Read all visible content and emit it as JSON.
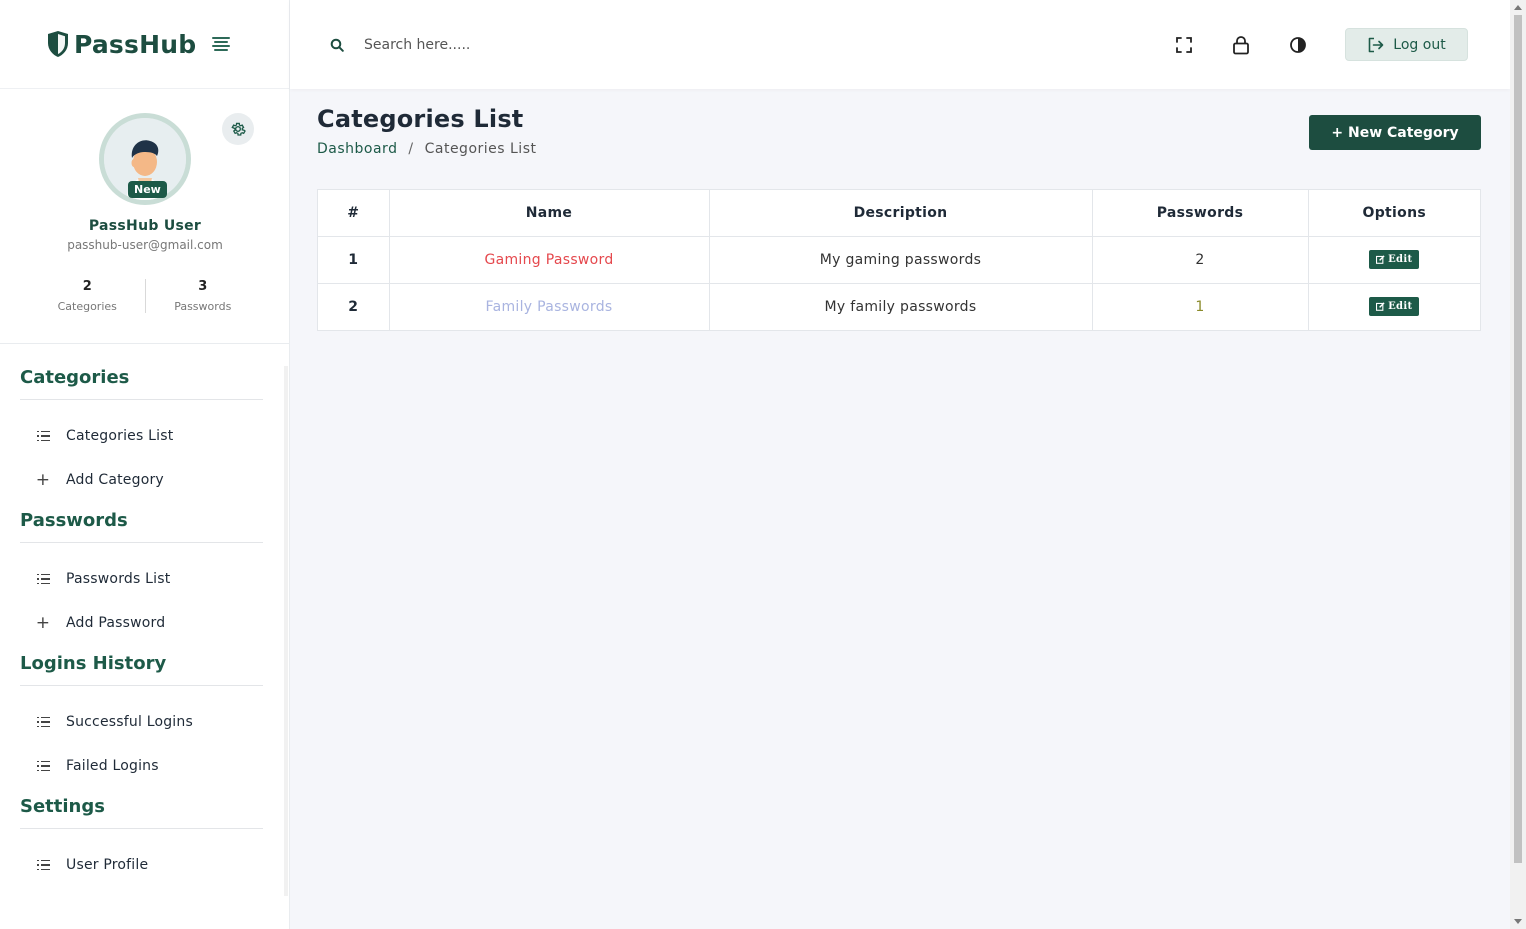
{
  "app": {
    "logo_text": "PassHub"
  },
  "profile": {
    "name": "PassHub User",
    "email": "passhub-user@gmail.com",
    "badge": "New",
    "stats": [
      {
        "value": "2",
        "label": "Categories"
      },
      {
        "value": "3",
        "label": "Passwords"
      }
    ]
  },
  "nav": {
    "sections": [
      {
        "title": "Categories",
        "items": [
          {
            "label": "Categories List",
            "icon": "list-icon"
          },
          {
            "label": "Add Category",
            "icon": "plus-icon"
          }
        ]
      },
      {
        "title": "Passwords",
        "items": [
          {
            "label": "Passwords List",
            "icon": "list-icon"
          },
          {
            "label": "Add Password",
            "icon": "plus-icon"
          }
        ]
      },
      {
        "title": "Logins History",
        "items": [
          {
            "label": "Successful Logins",
            "icon": "list-icon"
          },
          {
            "label": "Failed Logins",
            "icon": "list-icon"
          }
        ]
      },
      {
        "title": "Settings",
        "items": [
          {
            "label": "User Profile",
            "icon": "list-icon"
          }
        ]
      }
    ]
  },
  "topbar": {
    "search_placeholder": "Search here.....",
    "logout_label": "Log out"
  },
  "page": {
    "title": "Categories List",
    "breadcrumb": {
      "home": "Dashboard",
      "separator": "/",
      "current": "Categories List"
    },
    "new_button": "+ New Category"
  },
  "table": {
    "headers": [
      "#",
      "Name",
      "Description",
      "Passwords",
      "Options"
    ],
    "rows": [
      {
        "index": "1",
        "name": "Gaming Password",
        "name_color": "#e5484d",
        "description": "My gaming passwords",
        "passwords": "2",
        "passwords_color": "#333333",
        "action": "Edit"
      },
      {
        "index": "2",
        "name": "Family Passwords",
        "name_color": "#a9b4e0",
        "description": "My family passwords",
        "passwords": "1",
        "passwords_color": "#8a8a2a",
        "action": "Edit"
      }
    ]
  },
  "colors": {
    "primary": "#1d4d40",
    "accent": "#1d5a48",
    "background": "#f5f6fa"
  }
}
